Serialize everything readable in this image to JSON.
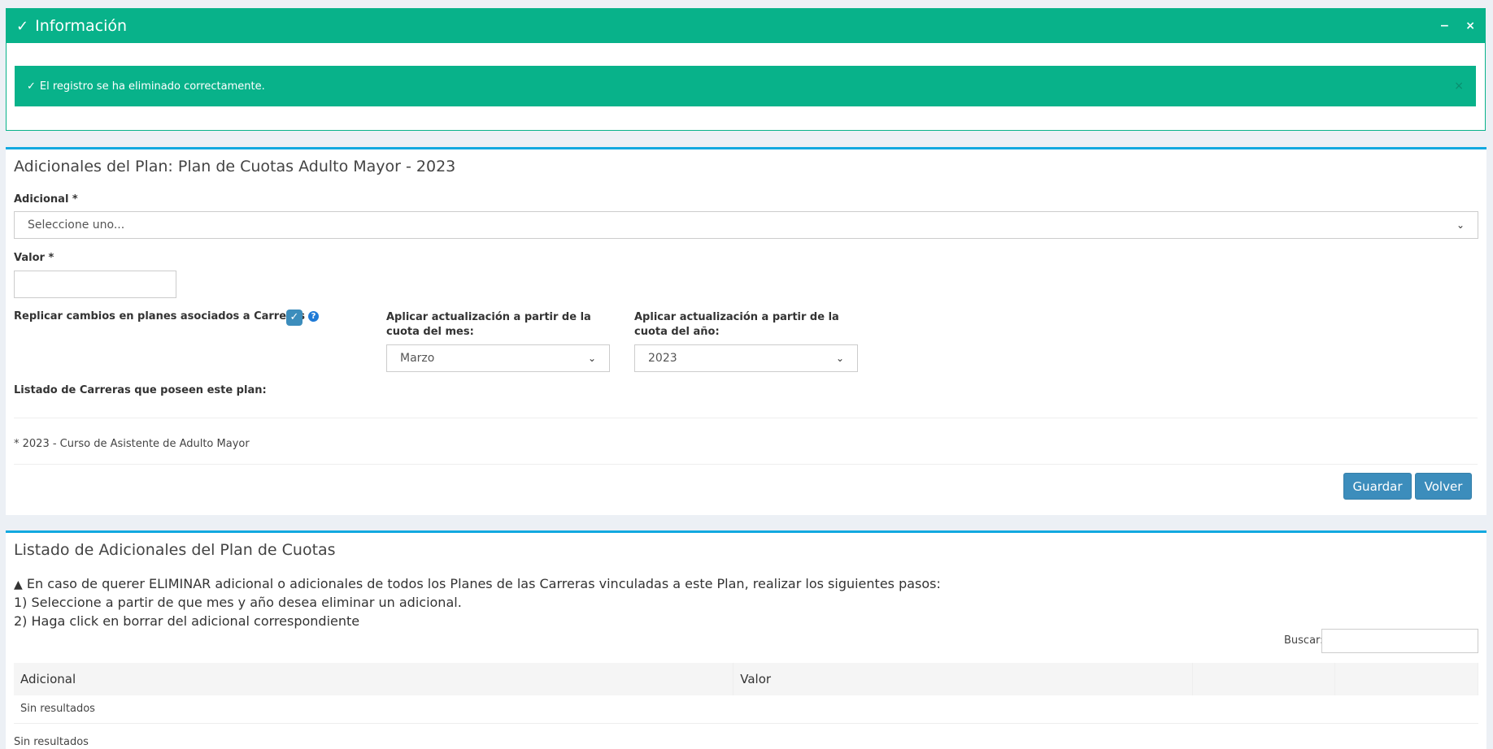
{
  "info": {
    "title": "Información",
    "check_icon": "✓",
    "minimize": "−",
    "close": "×",
    "alert_message": "El registro se ha eliminado correctamente.",
    "alert_close": "×"
  },
  "form": {
    "title": "Adicionales del Plan: Plan de Cuotas Adulto Mayor - 2023",
    "adicional_label": "Adicional *",
    "adicional_value": "Seleccione uno...",
    "valor_label": "Valor *",
    "valor_value": "",
    "replicar_label": "Replicar cambios en planes asociados a Carreras",
    "help_icon": "?",
    "mes_label": "Aplicar actualización a partir de la cuota del mes:",
    "mes_value": "Marzo",
    "anio_label": "Aplicar actualización a partir de la cuota del año:",
    "anio_value": "2023",
    "listado_label": "Listado de Carreras que poseen este plan:",
    "carrera_item": "* 2023 - Curso de Asistente de Adulto Mayor",
    "guardar": "Guardar",
    "volver": "Volver"
  },
  "list": {
    "title": "Listado de Adicionales del Plan de Cuotas",
    "warning_line": "En caso de querer ELIMINAR adicional o adicionales de todos los Planes de las Carreras vinculadas a este Plan, realizar los siguientes pasos:",
    "step1": "1) Seleccione a partir de que mes y año desea eliminar un adicional.",
    "step2": "2) Haga click en borrar del adicional correspondiente",
    "search_label": "Buscar:",
    "columns": [
      "Adicional",
      "Valor",
      "",
      ""
    ],
    "empty_row": "Sin resultados",
    "footer": "Sin resultados"
  },
  "colors": {
    "success": "#08b28a",
    "primary": "#3c8dbc",
    "panel_border": "#12a9e0"
  }
}
